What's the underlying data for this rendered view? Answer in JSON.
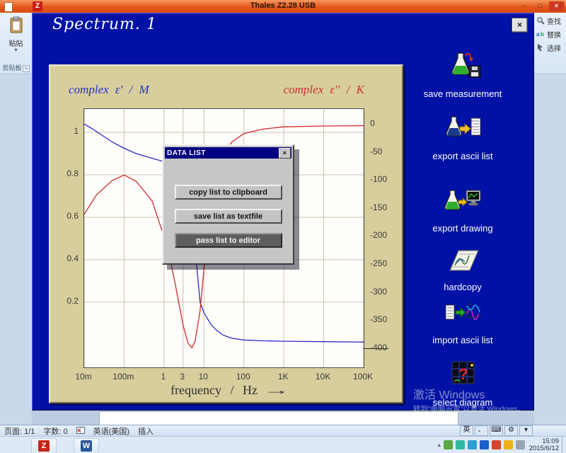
{
  "titlebar": {
    "title": "Thales Z2.28 USB",
    "app_icon_letter": "Z",
    "minimize_glyph": "–",
    "maximize_glyph": "□",
    "close_glyph": "×"
  },
  "word": {
    "ribbon_left": {
      "paste_label": "粘贴",
      "dropdown_glyph": "▾",
      "group_label": "剪贴板",
      "launcher_glyph": "↘"
    },
    "ribbon_right": {
      "find": "查找",
      "replace": "替换",
      "select": "选择"
    },
    "status": {
      "page": "页面: 1/1",
      "words": "字数: 0",
      "language": "英语(美国)",
      "mode": "插入"
    }
  },
  "ime": {
    "items": [
      "英",
      "、",
      "⌨",
      "⚙",
      "▾"
    ]
  },
  "thales": {
    "title": "Spectrum. 1",
    "close_glyph": "×",
    "menu": [
      {
        "label": "save measurement"
      },
      {
        "label": "export ascii list"
      },
      {
        "label": "export drawing"
      },
      {
        "label": "hardcopy"
      },
      {
        "label": "import ascii list"
      },
      {
        "label": "select diagram"
      }
    ],
    "dialog": {
      "title": "DATA LIST",
      "close_glyph": "×",
      "buttons": [
        {
          "label": "copy list to clipboard",
          "active": false
        },
        {
          "label": "save list as textfile",
          "active": false
        },
        {
          "label": "pass list to editor",
          "active": true
        }
      ]
    }
  },
  "chart_data": {
    "type": "line",
    "title_left": "complex ε' / M",
    "title_right": "complex ε'' / K",
    "xlabel": "frequency / Hz",
    "x_arrow": "→",
    "x_scale": "log",
    "x_range": [
      0.01,
      100000
    ],
    "x_ticks": [
      {
        "value": 0.01,
        "label": "10m"
      },
      {
        "value": 0.1,
        "label": "100m"
      },
      {
        "value": 1,
        "label": "1"
      },
      {
        "value": 3,
        "label": "3"
      },
      {
        "value": 10,
        "label": "10"
      },
      {
        "value": 100,
        "label": "100"
      },
      {
        "value": 1000,
        "label": "1K"
      },
      {
        "value": 10000,
        "label": "10K"
      },
      {
        "value": 100000,
        "label": "100K"
      }
    ],
    "left_axis": {
      "label": "complex ε' / M",
      "min": -0.107,
      "max": 1.11,
      "ticks": [
        1,
        0.8,
        0.6,
        0.4,
        0.2
      ]
    },
    "right_axis": {
      "label": "complex ε'' / K",
      "min": -433,
      "max": 27.8,
      "ticks": [
        0,
        -50,
        -100,
        -150,
        -200,
        -250,
        -300,
        -350,
        -400
      ]
    },
    "grid": true,
    "legend": "none",
    "marker": {
      "axis": "right",
      "value": -400
    },
    "series": [
      {
        "name": "complex eps real (M)",
        "axis": "left",
        "color": "#2a2ac8",
        "points": [
          [
            0.01,
            1.04
          ],
          [
            0.02,
            1.005
          ],
          [
            0.05,
            0.955
          ],
          [
            0.1,
            0.925
          ],
          [
            0.2,
            0.9
          ],
          [
            0.5,
            0.878
          ],
          [
            1,
            0.862
          ],
          [
            2,
            0.83
          ],
          [
            3,
            0.77
          ],
          [
            4,
            0.665
          ],
          [
            5,
            0.55
          ],
          [
            6,
            0.45
          ],
          [
            8,
            0.2
          ],
          [
            10,
            0.15
          ],
          [
            15,
            0.095
          ],
          [
            20,
            0.07
          ],
          [
            30,
            0.045
          ],
          [
            50,
            0.03
          ],
          [
            100,
            0.022
          ],
          [
            300,
            0.018
          ],
          [
            1000,
            0.016
          ],
          [
            10000,
            0.014
          ],
          [
            100000,
            0.012
          ]
        ]
      },
      {
        "name": "complex eps imaginary (K)",
        "axis": "right",
        "color": "#cc2a2a",
        "points": [
          [
            0.01,
            -160
          ],
          [
            0.02,
            -126
          ],
          [
            0.05,
            -100
          ],
          [
            0.1,
            -90
          ],
          [
            0.2,
            -101
          ],
          [
            0.5,
            -136
          ],
          [
            1,
            -200
          ],
          [
            1.5,
            -248
          ],
          [
            2,
            -292
          ],
          [
            3,
            -358
          ],
          [
            4,
            -390
          ],
          [
            5,
            -398
          ],
          [
            6,
            -386
          ],
          [
            8,
            -332
          ],
          [
            10,
            -258
          ],
          [
            15,
            -152
          ],
          [
            20,
            -98
          ],
          [
            30,
            -56
          ],
          [
            50,
            -31
          ],
          [
            100,
            -16
          ],
          [
            300,
            -8
          ],
          [
            1000,
            -4
          ],
          [
            10000,
            -2.5
          ],
          [
            100000,
            -2
          ]
        ]
      }
    ]
  },
  "taskbar": {
    "apps": [
      {
        "name": "thales",
        "letter": "Z",
        "color": "#c9231a"
      },
      {
        "name": "word",
        "letter": "W",
        "color": "#2b579a"
      }
    ],
    "tray_arrow": "▴",
    "tray_icons": [
      {
        "name": "tray-icon",
        "color": "#58a844"
      },
      {
        "name": "tray-icon",
        "color": "#30b8a0"
      },
      {
        "name": "tray-icon",
        "color": "#2e9fd4"
      },
      {
        "name": "tray-icon",
        "color": "#1b5fc8"
      },
      {
        "name": "tray-icon",
        "color": "#d8432c"
      },
      {
        "name": "tray-icon",
        "color": "#f0b01c"
      },
      {
        "name": "tray-icon",
        "color": "#98a4b4"
      }
    ],
    "time": "15:09",
    "date": "2015/6/12"
  },
  "watermark": {
    "line1": "激活 Windows",
    "line2": "转到“电脑设置”以激活 Windows。"
  }
}
